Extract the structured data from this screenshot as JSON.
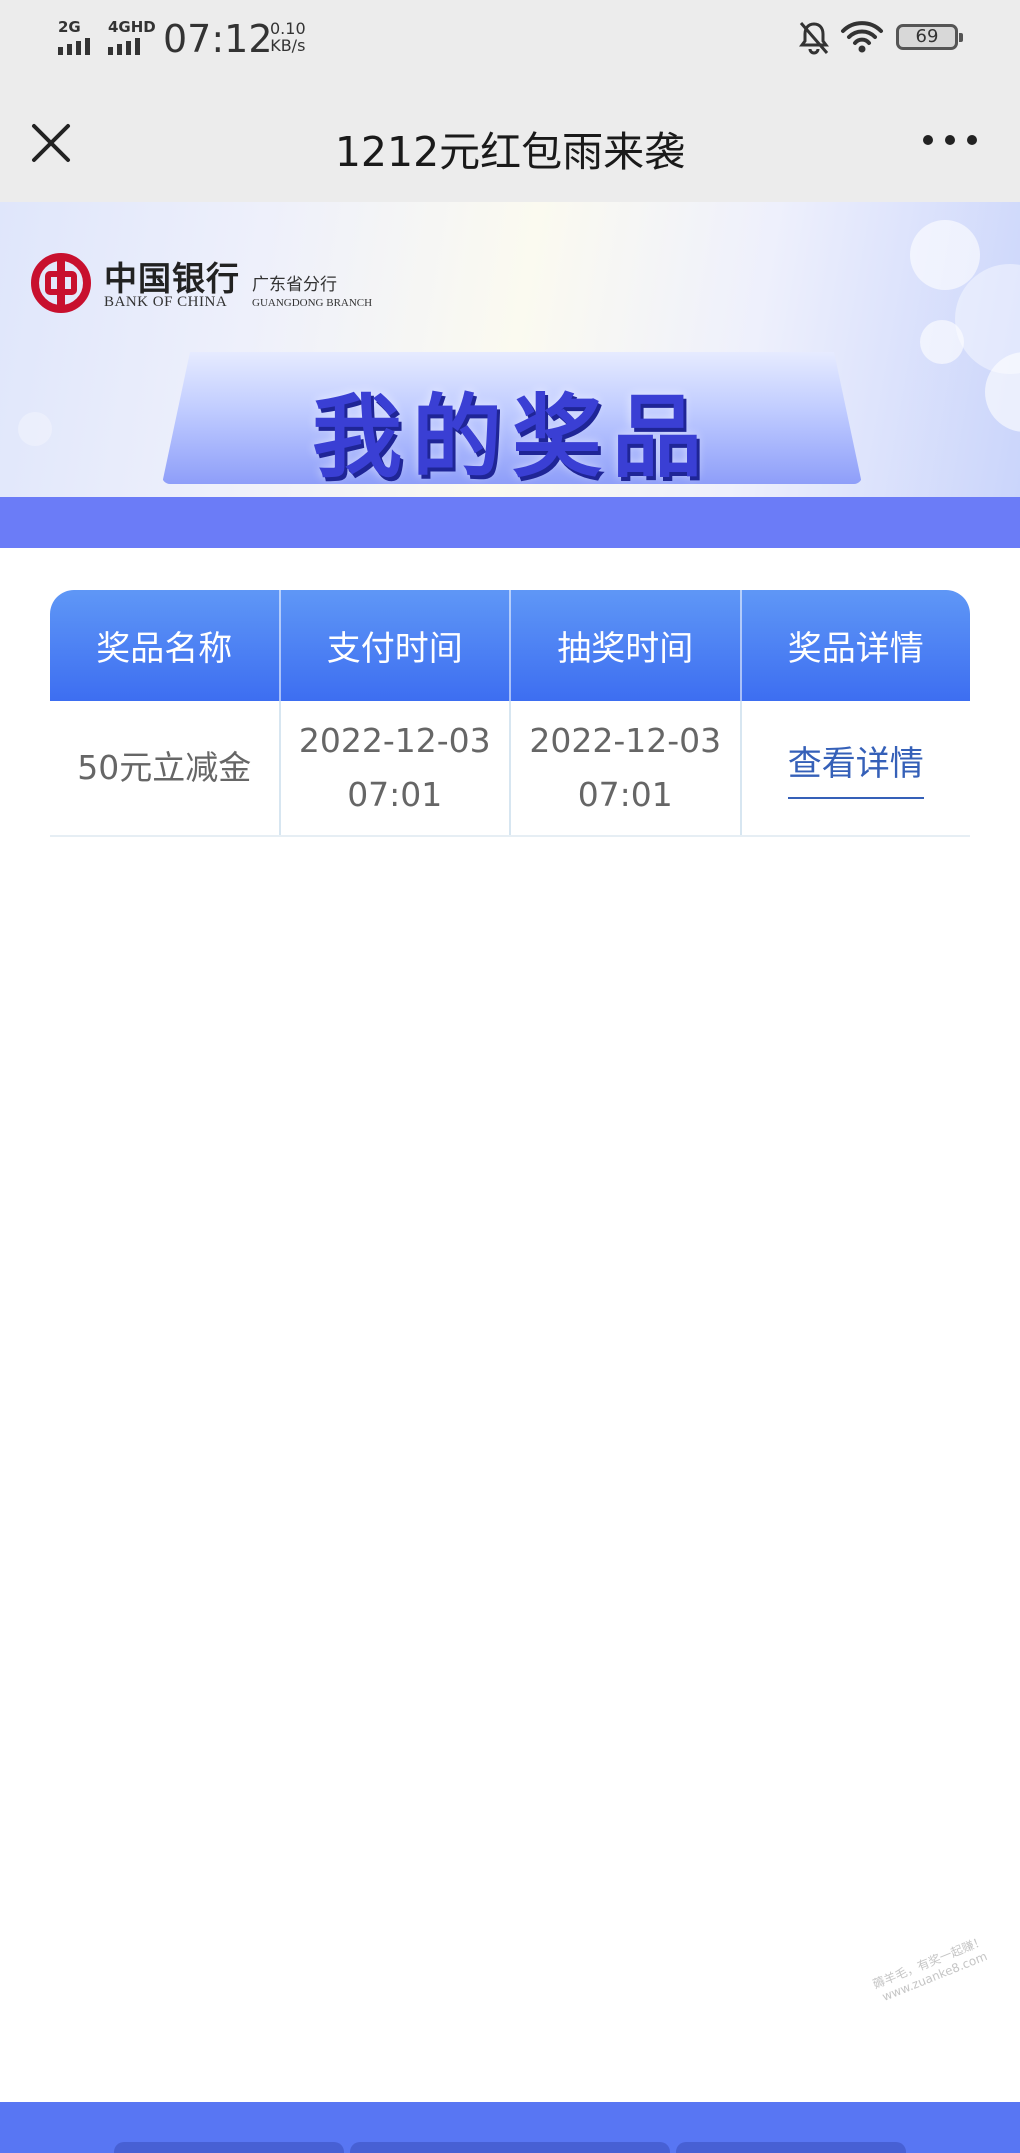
{
  "status": {
    "sim1": "2G",
    "sim2": "4GHD",
    "time": "07:12",
    "speed_value": "0.10",
    "speed_unit": "KB/s",
    "battery": "69"
  },
  "nav": {
    "title": "1212元红包雨来袭",
    "close_icon": "close-icon",
    "more_icon": "more-icon"
  },
  "banner": {
    "bank_name_cn": "中国银行",
    "bank_name_en": "BANK OF CHINA",
    "branch_cn": "广东省分行",
    "branch_en": "GUANGDONG BRANCH",
    "heading": "我的奖品",
    "brand_color": "#c8102e",
    "band_color": "#6b7cf7"
  },
  "table": {
    "columns": [
      "奖品名称",
      "支付时间",
      "抽奖时间",
      "奖品详情"
    ],
    "rows": [
      {
        "prize": "50元立减金",
        "pay_date": "2022-12-03",
        "pay_time": "07:01",
        "draw_date": "2022-12-03",
        "draw_time": "07:01",
        "detail_link": "查看详情"
      }
    ],
    "header_color": "#4a80f4",
    "link_color": "#3560b8"
  },
  "watermark": {
    "line1": "薅羊毛，有奖一起赚！",
    "line2": "www.zuanke8.com"
  }
}
